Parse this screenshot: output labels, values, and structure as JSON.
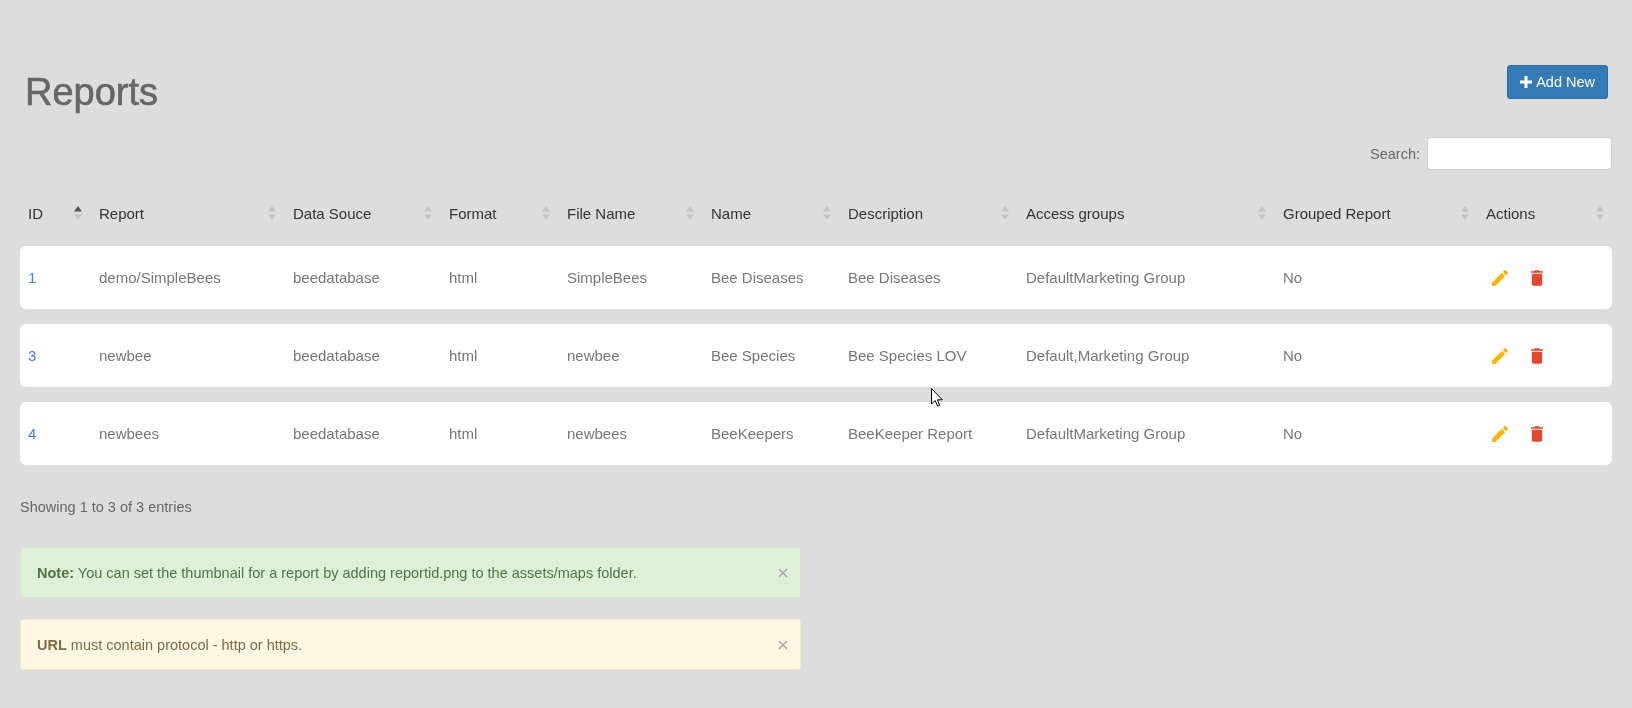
{
  "page": {
    "title": "Reports"
  },
  "add_button": {
    "label": "Add New"
  },
  "search": {
    "label": "Search:"
  },
  "table": {
    "columns": [
      {
        "label": "ID",
        "sorted": true
      },
      {
        "label": "Report",
        "sorted": false
      },
      {
        "label": "Data Souce",
        "sorted": false
      },
      {
        "label": "Format",
        "sorted": false
      },
      {
        "label": "File Name",
        "sorted": false
      },
      {
        "label": "Name",
        "sorted": false
      },
      {
        "label": "Description",
        "sorted": false
      },
      {
        "label": "Access groups",
        "sorted": false
      },
      {
        "label": "Grouped Report",
        "sorted": false
      },
      {
        "label": "Actions",
        "sorted": false
      }
    ],
    "rows": [
      {
        "cells": [
          "1",
          "demo/SimpleBees",
          "beedatabase",
          "html",
          "SimpleBees",
          "Bee Diseases",
          "Bee Diseases",
          "DefaultMarketing Group",
          "No"
        ]
      },
      {
        "cells": [
          "3",
          "newbee",
          "beedatabase",
          "html",
          "newbee",
          "Bee Species",
          "Bee Species LOV",
          "Default,Marketing Group",
          "No"
        ]
      },
      {
        "cells": [
          "4",
          "newbees",
          "beedatabase",
          "html",
          "newbees",
          "BeeKeepers",
          "BeeKeeper Report",
          "DefaultMarketing Group",
          "No"
        ]
      }
    ]
  },
  "table_info": "Showing 1 to 3 of 3 entries",
  "alerts": [
    {
      "kind": "success",
      "text": "**Note:** You can set the thumbnail for a report by adding reportid.png to the assets/maps folder."
    },
    {
      "kind": "warning",
      "text": "**URL** must contain protocol - http or https."
    }
  ]
}
